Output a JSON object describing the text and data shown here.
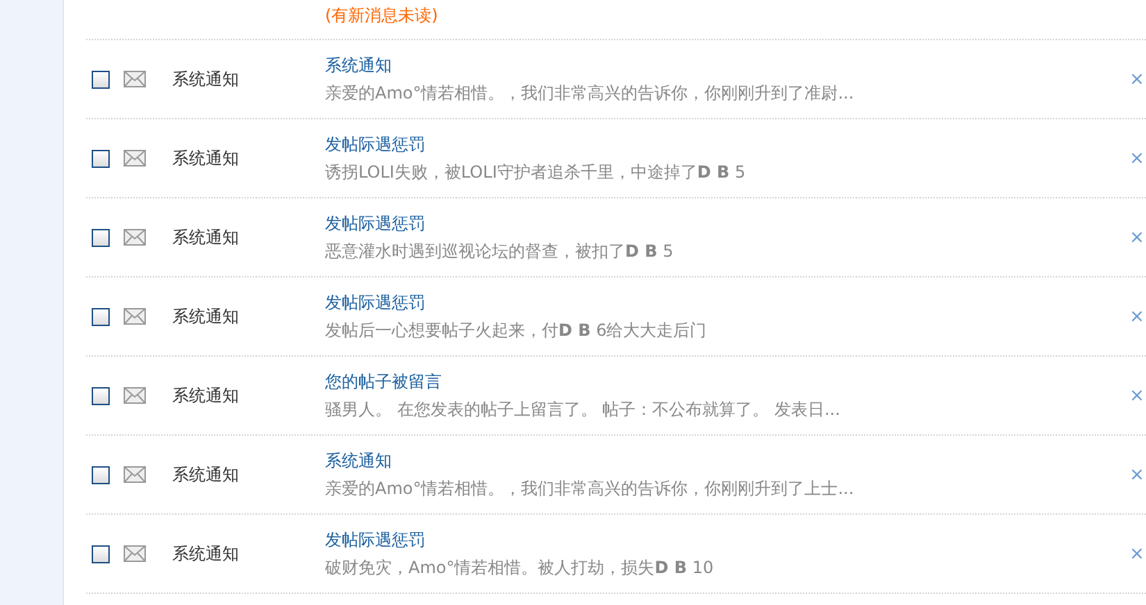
{
  "top_notice": "(有新消息未读)",
  "messages": [
    {
      "checked": false,
      "sender": "系统通知",
      "title": "系统通知",
      "snippet": "亲爱的Amo°情若相惜。，我们非常高兴的告诉你，你刚刚升到了准尉...",
      "close": "×"
    },
    {
      "checked": false,
      "sender": "系统通知",
      "title": "发帖际遇惩罚",
      "snippet": "诱拐LOLI失败，被LOLI守护者追杀千里，中途掉了**D B** 5",
      "close": "×"
    },
    {
      "checked": false,
      "sender": "系统通知",
      "title": "发帖际遇惩罚",
      "snippet": "恶意灌水时遇到巡视论坛的督查，被扣了**D B** 5",
      "close": "×"
    },
    {
      "checked": false,
      "sender": "系统通知",
      "title": "发帖际遇惩罚",
      "snippet": "发帖后一心想要帖子火起来，付**D B** 6给大大走后门",
      "close": "×"
    },
    {
      "checked": false,
      "sender": "系统通知",
      "title": "您的帖子被留言",
      "snippet": "骚男人。 在您发表的帖子上留言了。 帖子：不公布就算了。 发表日...",
      "close": "×"
    },
    {
      "checked": false,
      "sender": "系统通知",
      "title": "系统通知",
      "snippet": "亲爱的Amo°情若相惜。，我们非常高兴的告诉你，你刚刚升到了上士...",
      "close": "×"
    },
    {
      "checked": false,
      "sender": "系统通知",
      "title": "发帖际遇惩罚",
      "snippet": "破财免灾，Amo°情若相惜。被人打劫，损失**D B** 10",
      "close": "×"
    }
  ]
}
